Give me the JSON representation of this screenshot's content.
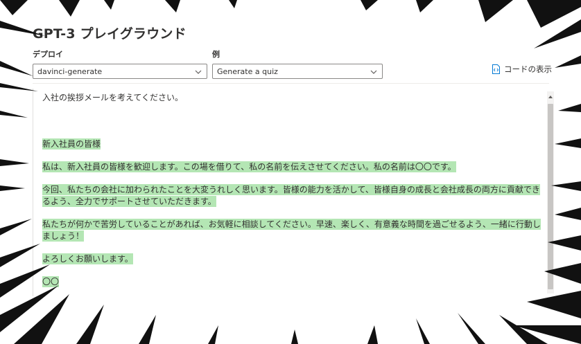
{
  "page": {
    "title": "GPT-3 プレイグラウンド"
  },
  "deploy": {
    "label": "デプロイ",
    "value": "davinci-generate"
  },
  "example": {
    "label": "例",
    "value": "Generate a quiz"
  },
  "code_view": {
    "label": "コードの表示",
    "icon": "code-file-icon"
  },
  "editor": {
    "prompt": "入社の挨拶メールを考えてください。",
    "completion": {
      "p1": "新入社員の皆様",
      "p2": "私は、新入社員の皆様を歓迎します。この場を借りて、私の名前を伝えさせてください。私の名前は〇〇です。",
      "p3": "今回、私たちの会社に加わられたことを大変うれしく思います。皆様の能力を活かして、皆様自身の成長と会社成長の両方に貢献できるよう、全力でサポートさせていただきます。",
      "p4": "私たちが何かで苦労していることがあれば、お気軽に相談してください。早速、楽しく、有意義な時間を過ごせるよう、一緒に行動しましょう！",
      "p5": "よろしくお願いします。",
      "p6": "〇〇"
    }
  },
  "colors": {
    "highlight": "#b4e6b4",
    "accent": "#0078d4",
    "text": "#323130"
  }
}
